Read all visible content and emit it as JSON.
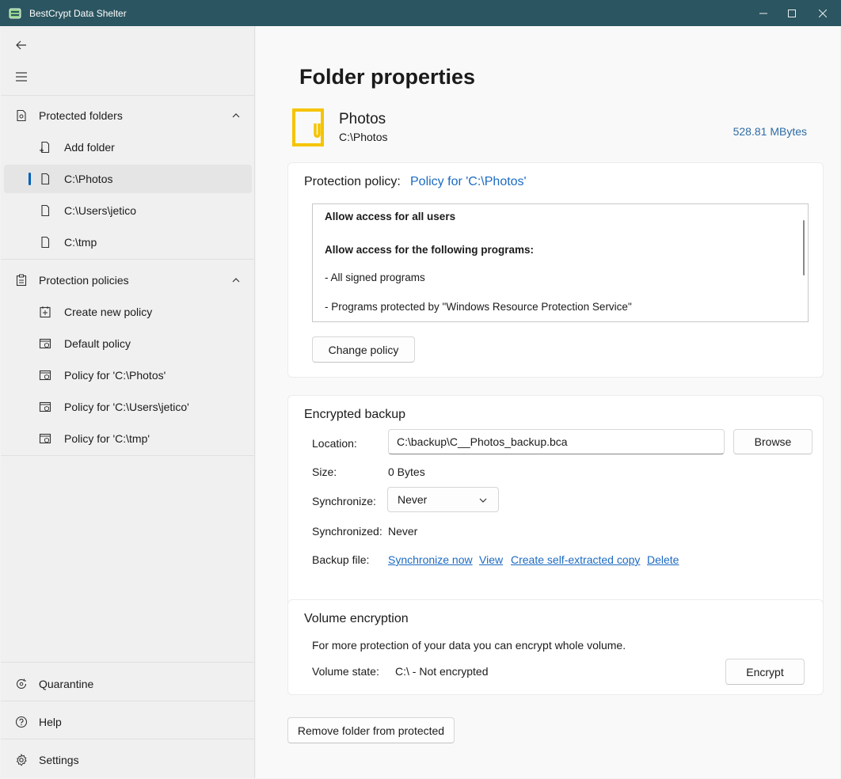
{
  "window": {
    "title": "BestCrypt Data Shelter"
  },
  "sidebar": {
    "protected_folders": {
      "label": "Protected folders",
      "items": [
        {
          "label": "Add folder",
          "icon": "add-folder-icon"
        },
        {
          "label": "C:\\Photos",
          "icon": "folder-icon",
          "selected": true
        },
        {
          "label": "C:\\Users\\jetico",
          "icon": "folder-icon"
        },
        {
          "label": "C:\\tmp",
          "icon": "folder-icon"
        }
      ]
    },
    "protection_policies": {
      "label": "Protection policies",
      "items": [
        {
          "label": "Create new policy",
          "icon": "new-policy-icon"
        },
        {
          "label": "Default policy",
          "icon": "policy-icon"
        },
        {
          "label": "Policy for 'C:\\Photos'",
          "icon": "policy-icon"
        },
        {
          "label": "Policy for 'C:\\Users\\jetico'",
          "icon": "policy-icon"
        },
        {
          "label": "Policy for 'C:\\tmp'",
          "icon": "policy-icon"
        }
      ]
    },
    "bottom": {
      "quarantine": "Quarantine",
      "help": "Help",
      "settings": "Settings"
    }
  },
  "main": {
    "title": "Folder properties",
    "folder": {
      "name": "Photos",
      "path": "C:\\Photos",
      "size": "528.81 MBytes"
    },
    "protection": {
      "label": "Protection policy:",
      "policy_link": "Policy for 'C:\\Photos'",
      "lines": [
        "Allow access for all users",
        "Allow access for the following programs:",
        "- All signed programs",
        "- Programs protected by \"Windows Resource Protection Service\""
      ],
      "change_button": "Change policy"
    },
    "backup": {
      "title": "Encrypted backup",
      "location_label": "Location:",
      "location_value": "C:\\backup\\C__Photos_backup.bca",
      "browse_button": "Browse",
      "size_label": "Size:",
      "size_value": "0 Bytes",
      "sync_label": "Synchronize:",
      "sync_value": "Never",
      "synced_label": "Synchronized:",
      "synced_value": "Never",
      "file_label": "Backup file:",
      "actions": {
        "sync_now": "Synchronize now",
        "view": "View",
        "self_extract": "Create self-extracted copy",
        "delete": "Delete"
      }
    },
    "volume": {
      "title": "Volume encryption",
      "description": "For more protection of your data you can encrypt whole volume.",
      "state_label": "Volume state:",
      "state_value": "C:\\ - Not encrypted",
      "encrypt_button": "Encrypt"
    },
    "remove_button": "Remove folder from protected"
  },
  "colors": {
    "titlebar": "#2b5560",
    "accent": "#005fb8",
    "link": "#1b6ac2",
    "folder_icon": "#f5c400"
  }
}
